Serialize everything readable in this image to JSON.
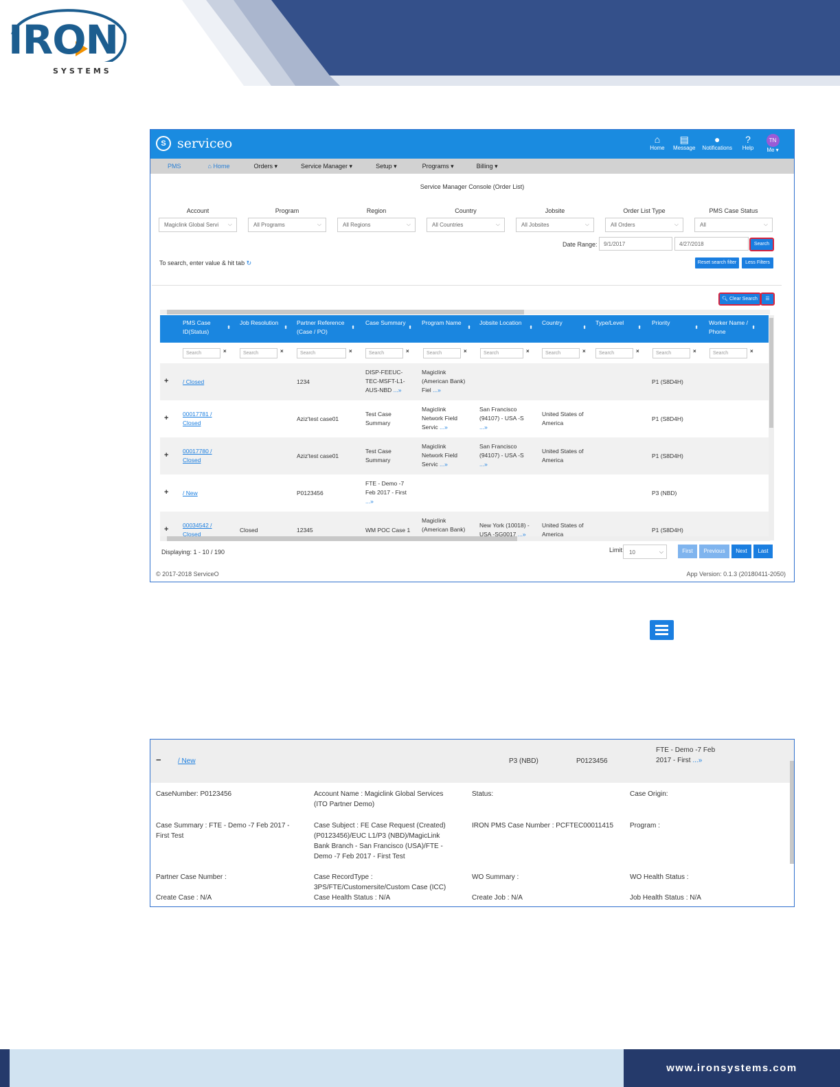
{
  "brand": {
    "logo_word": "IRON",
    "logo_sub": "SYSTEMS",
    "footer_url": "www.ironsystems.com"
  },
  "app": {
    "name": "serviceo",
    "logo_glyph": "S",
    "top_icons": [
      {
        "icon": "home-icon",
        "glyph": "⌂",
        "label": "Home"
      },
      {
        "icon": "message-icon",
        "glyph": "▤",
        "label": "Message"
      },
      {
        "icon": "bell-icon",
        "glyph": "●",
        "label": "Notifications"
      },
      {
        "icon": "help-icon",
        "glyph": "?",
        "label": "Help"
      }
    ],
    "user": {
      "initials": "TN",
      "label": "Me ▾"
    },
    "menu": [
      "PMS",
      "⌂ Home",
      "Orders ▾",
      "Service Manager ▾",
      "Setup ▾",
      "Programs ▾",
      "Billing ▾"
    ],
    "page_title": "Service Manager Console (Order List)",
    "filters": [
      {
        "label": "Account",
        "value": "Magiclink Global Servi"
      },
      {
        "label": "Program",
        "value": "All Programs"
      },
      {
        "label": "Region",
        "value": "All Regions"
      },
      {
        "label": "Country",
        "value": "All Countries"
      },
      {
        "label": "Jobsite",
        "value": "All Jobsites"
      },
      {
        "label": "Order List Type",
        "value": "All Orders"
      },
      {
        "label": "PMS Case Status",
        "value": "All"
      }
    ],
    "date_range": {
      "label": "Date Range:",
      "from": "9/1/2017",
      "to": "4/27/2018"
    },
    "buttons": {
      "search": "Search",
      "reset": "Reset search filter",
      "less": "Less Filters",
      "clear": "Clear Search"
    },
    "hint": "To search, enter value & hit tab",
    "columns": [
      "PMS Case ID(Status)",
      "Job Resolution",
      "Partner Reference (Case / PO)",
      "Case Summary",
      "Program Name",
      "Jobsite Location",
      "Country",
      "Type/Level",
      "Priority",
      "Worker Name / Phone"
    ],
    "search_placeholder": "Search",
    "rows": [
      {
        "id": "/ Closed",
        "res": "",
        "ref": "1234",
        "summary": "DISP-FEEUC-TEC-MSFT-L1-AUS-NBD",
        "program": "Magiclink (American Bank) Fiel",
        "location": "",
        "country": "",
        "priority": "P1 (S8D4H)"
      },
      {
        "id": "00017781 / Closed",
        "res": "",
        "ref": "Aziz'test case01",
        "summary": "Test Case Summary",
        "program": "Magiclink Network Field Servic",
        "location": "San Francisco (94107) - USA -S",
        "country": "United States of America",
        "priority": "P1 (S8D4H)"
      },
      {
        "id": "00017780 / Closed",
        "res": "",
        "ref": "Aziz'test case01",
        "summary": "Test Case Summary",
        "program": "Magiclink Network Field Servic",
        "location": "San Francisco (94107) - USA -S",
        "country": "United States of America",
        "priority": "P1 (S8D4H)"
      },
      {
        "id": "/ New",
        "res": "",
        "ref": "P0123456",
        "summary": "FTE - Demo -7 Feb 2017 - First",
        "program": "",
        "location": "",
        "country": "",
        "priority": "P3 (NBD)"
      },
      {
        "id": "00034542 / Closed",
        "res": "Closed",
        "ref": "12345",
        "summary": "WM POC Case 1",
        "program": "Magiclink (American Bank)",
        "location": "New York (10018) - USA -SG0017",
        "country": "United States of America",
        "priority": "P1 (S8D4H)"
      }
    ],
    "more_glyph": "...»",
    "displaying": "Displaying: 1 - 10 / 190",
    "limit_label": "Limit:",
    "limit_value": "10",
    "pager": [
      "First",
      "Previous",
      "Next",
      "Last"
    ],
    "copyright": "© 2017-2018 ServiceO",
    "version": "App Version: 0.1.3 (20180411-2050)"
  },
  "detail": {
    "row": {
      "toggle": "−",
      "id": "/ New",
      "priority": "P3 (NBD)",
      "ref": "P0123456",
      "summary": "FTE - Demo -7 Feb 2017 - First"
    },
    "fields": [
      [
        "CaseNumber: P0123456",
        "Account Name : Magiclink Global Services (ITO Partner Demo)",
        "Status:",
        "Case Origin:"
      ],
      [
        "Case Summary : FTE - Demo -7 Feb 2017 - First Test",
        "Case Subject : FE Case Request (Created) (P0123456)/EUC L1/P3 (NBD)/MagicLink Bank Branch - San Francisco (USA)/FTE - Demo -7 Feb 2017 - First Test",
        "IRON PMS Case Number : PCFTEC00011415",
        "Program :"
      ],
      [
        "Partner Case Number :",
        "Case RecordType : 3PS/FTE/Customersite/Custom Case (ICC)",
        "WO Summary :",
        "WO Health Status :"
      ],
      [
        "Create Case : N/A",
        "Case Health Status : N/A",
        "Create Job : N/A",
        "Job Health Status : N/A"
      ]
    ]
  },
  "colors": {
    "brand_navy": "#253a6b",
    "app_blue": "#1a8be0",
    "highlight_red": "#d9213b"
  }
}
